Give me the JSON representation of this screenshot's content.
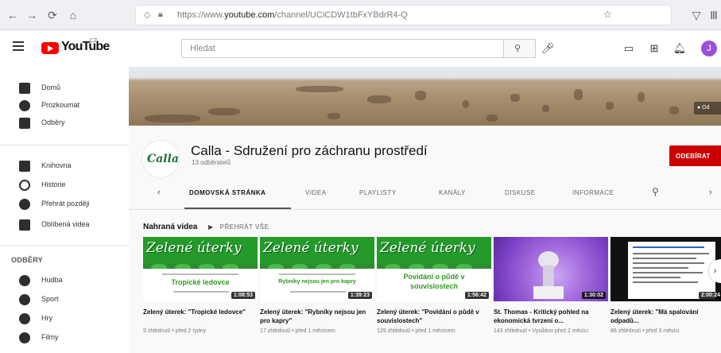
{
  "browser": {
    "url_prefix": "https://www.",
    "url_domain": "youtube.com",
    "url_path": "/channel/UCiCDW1tbFxYBdrR4-Q"
  },
  "header": {
    "logo_text": "YouTube",
    "logo_region": "CZ",
    "search_placeholder": "Hledat",
    "avatar_letter": "J"
  },
  "sidebar": {
    "main": [
      {
        "label": "Domů"
      },
      {
        "label": "Prozkoumat"
      },
      {
        "label": "Odběry"
      }
    ],
    "library": [
      {
        "label": "Knihovna"
      },
      {
        "label": "Historie"
      },
      {
        "label": "Přehrát později"
      },
      {
        "label": "Oblíbená videa"
      }
    ],
    "subs_heading": "ODBĚRY",
    "subs": [
      {
        "label": "Hudba"
      },
      {
        "label": "Sport"
      },
      {
        "label": "Hry"
      },
      {
        "label": "Filmy"
      }
    ]
  },
  "banner": {
    "button_label": "● Od"
  },
  "channel": {
    "logo_text": "Calla",
    "name": "Calla - Sdružení pro záchranu prostředí",
    "subscribers": "13 odběratelů",
    "subscribe_label": "ODEBÍRAT",
    "tabs": [
      "DOMOVSKÁ STRÁNKA",
      "VIDEA",
      "PLAYLISTY",
      "KANÁLY",
      "DISKUSE",
      "INFORMACE"
    ]
  },
  "uploads": {
    "title": "Nahraná videa",
    "play_all": "PŘEHRÁT VŠE",
    "videos": [
      {
        "thumb_title": "Zelené úterky",
        "thumb_subtitle": "Tropické ledovce",
        "duration": "1:08:53",
        "title": "Zelený úterek: \"Tropické ledovce\"",
        "meta": "9 zhlédnutí • před 2 týdny"
      },
      {
        "thumb_title": "Zelené úterky",
        "thumb_subtitle": "Rybníky nejsou jen pro kapry",
        "duration": "1:39:23",
        "title": "Zelený úterek: \"Rybníky nejsou jen pro kapry\"",
        "meta": "17 zhlédnutí • před 1 měsícem"
      },
      {
        "thumb_title": "Zelené úterky",
        "thumb_subtitle": "Povídání o půdě v souvislostech",
        "duration": "1:56:42",
        "title": "Zelený úterek: \"Povídání o půdě v souvislostech\"",
        "meta": "129 zhlédnutí • před 1 měsícem"
      },
      {
        "duration": "1:30:02",
        "title": "St. Thomas - Kritický pohled na ekonomická tvrzení o...",
        "meta": "143 zhlédnutí • Vysíláno před 2 měsíci"
      },
      {
        "duration": "2:00:24",
        "title": "Zelený úterek: \"Má spalování odpadů...",
        "meta": "86 zhlédnutí • před 3 měsíci"
      }
    ]
  },
  "colors": {
    "brand_red": "#ff0000",
    "subscribe_red": "#cc0000",
    "thumb_green": "#249a2a"
  }
}
